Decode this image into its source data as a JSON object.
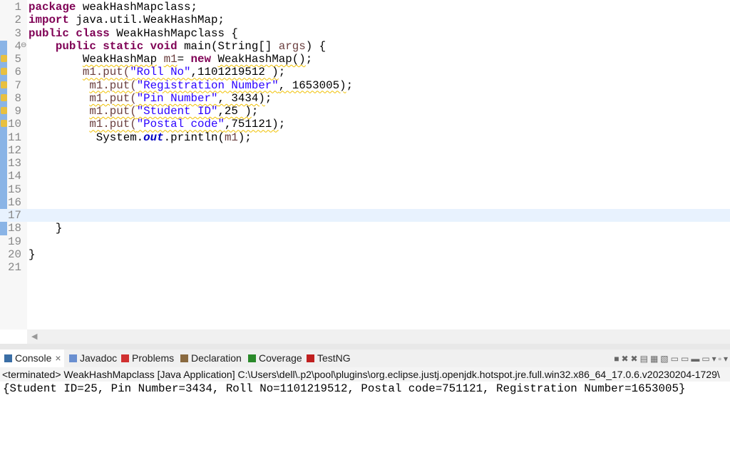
{
  "editor": {
    "lines": [
      [
        [
          [
            "package",
            "kw"
          ],
          [
            " weakHashMapclass;",
            ""
          ]
        ]
      ],
      [
        [
          [
            "import",
            "kw"
          ],
          [
            " java.util.WeakHashMap;",
            ""
          ]
        ]
      ],
      [
        [
          [
            "public",
            "kw"
          ],
          [
            " ",
            ""
          ],
          [
            "class",
            "kw"
          ],
          [
            " WeakHashMapclass {",
            ""
          ]
        ]
      ],
      [
        [
          [
            "    ",
            ""
          ],
          [
            "public",
            "kw"
          ],
          [
            " ",
            ""
          ],
          [
            "static",
            "kw"
          ],
          [
            " ",
            ""
          ],
          [
            "void",
            "kw"
          ],
          [
            " main(String[] ",
            ""
          ],
          [
            "args",
            "var"
          ],
          [
            ") {",
            ""
          ]
        ]
      ],
      [
        [
          [
            "        ",
            ""
          ],
          [
            "WeakHashMap",
            "sq"
          ],
          [
            " ",
            ""
          ],
          [
            "m1",
            "var sq"
          ],
          [
            "= ",
            ""
          ],
          [
            "new",
            "kw"
          ],
          [
            " ",
            ""
          ],
          [
            "WeakHashMap()",
            "sq"
          ],
          [
            ";",
            ""
          ]
        ]
      ],
      [
        [
          [
            "        ",
            ""
          ],
          [
            "m1.put(",
            "sq var"
          ],
          [
            "\"Roll No\"",
            "str sq"
          ],
          [
            ",1101219512 )",
            "sq"
          ],
          [
            ";",
            ""
          ]
        ]
      ],
      [
        [
          [
            "         ",
            ""
          ],
          [
            "m1.put(",
            "sq var"
          ],
          [
            "\"Registration Number\"",
            "str sq"
          ],
          [
            ", 1653005)",
            "sq"
          ],
          [
            ";",
            ""
          ]
        ]
      ],
      [
        [
          [
            "         ",
            ""
          ],
          [
            "m1.put(",
            "sq var"
          ],
          [
            "\"Pin Number\"",
            "str sq"
          ],
          [
            ", 3434)",
            "sq"
          ],
          [
            ";",
            ""
          ]
        ]
      ],
      [
        [
          [
            "         ",
            ""
          ],
          [
            "m1.put(",
            "sq var"
          ],
          [
            "\"Student ID\"",
            "str sq"
          ],
          [
            ",25 )",
            "sq"
          ],
          [
            ";",
            ""
          ]
        ]
      ],
      [
        [
          [
            "         ",
            ""
          ],
          [
            "m1.put(",
            "sq var"
          ],
          [
            "\"Postal code\"",
            "str sq"
          ],
          [
            ",751121)",
            "sq"
          ],
          [
            ";",
            ""
          ]
        ]
      ],
      [
        [
          [
            "          System.",
            ""
          ],
          [
            "out",
            "fld"
          ],
          [
            ".println(",
            ""
          ],
          [
            "m1",
            "var"
          ],
          [
            ");",
            ""
          ]
        ]
      ],
      [
        []
      ],
      [
        []
      ],
      [
        []
      ],
      [
        []
      ],
      [
        []
      ],
      [
        []
      ],
      [
        [
          [
            "    }",
            ""
          ]
        ]
      ],
      [
        []
      ],
      [
        [
          [
            "}",
            ""
          ]
        ]
      ],
      [
        []
      ]
    ],
    "warning_lines": [
      5,
      6,
      7,
      8,
      9,
      10
    ],
    "current_line": 17
  },
  "tabs": [
    {
      "label": "Console",
      "icon": "console-icon",
      "active": true,
      "close": "×"
    },
    {
      "label": "Javadoc",
      "icon": "javadoc-icon"
    },
    {
      "label": "Problems",
      "icon": "problems-icon"
    },
    {
      "label": "Declaration",
      "icon": "declaration-icon"
    },
    {
      "label": "Coverage",
      "icon": "coverage-icon"
    },
    {
      "label": "TestNG",
      "icon": "testng-icon"
    }
  ],
  "console": {
    "status": "<terminated> WeakHashMapclass [Java Application] C:\\Users\\dell\\.p2\\pool\\plugins\\org.eclipse.justj.openjdk.hotspot.jre.full.win32.x86_64_17.0.6.v20230204-1729\\",
    "output": "{Student ID=25, Pin Number=3434, Roll No=1101219512, Postal code=751121, Registration Number=1653005}"
  },
  "toolbar_icons": [
    "terminate-icon",
    "remove-launch-icon",
    "remove-all-icon",
    "clear-console-icon",
    "scroll-lock-icon",
    "word-wrap-icon",
    "show-stdout-icon",
    "show-stderr-icon",
    "pin-console-icon",
    "display-console-icon",
    "dropdown-icon",
    "open-console-icon",
    "view-menu-icon"
  ]
}
